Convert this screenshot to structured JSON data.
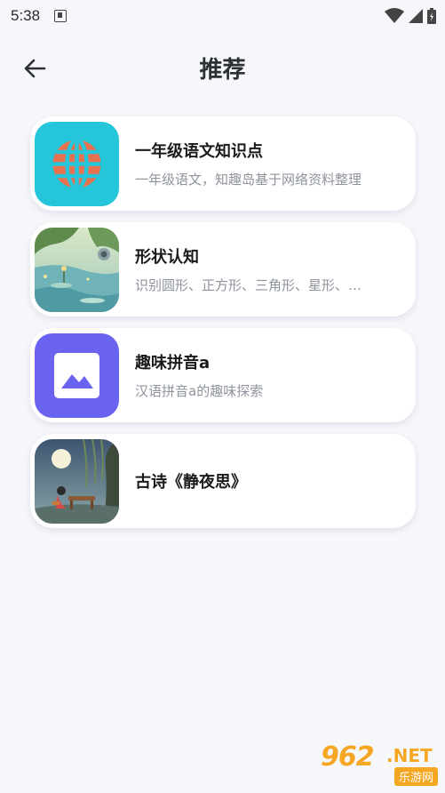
{
  "status_bar": {
    "time": "5:38"
  },
  "header": {
    "title": "推荐"
  },
  "colors": {
    "accent_teal": "#26c6da",
    "accent_purple": "#6a63f0",
    "globe_orange": "#e8714f"
  },
  "items": [
    {
      "title": "一年级语文知识点",
      "subtitle": "一年级语文，知趣岛基于网络资料整理",
      "icon": "globe-icon"
    },
    {
      "title": "形状认知",
      "subtitle": "识别圆形、正方形、三角形、星形、…",
      "icon": "landscape-painting"
    },
    {
      "title": "趣味拼音a",
      "subtitle": "汉语拼音a的趣味探索",
      "icon": "image-placeholder-icon"
    },
    {
      "title": "古诗《静夜思》",
      "subtitle": "",
      "icon": "moonlit-scene-painting"
    }
  ],
  "watermark": {
    "brand": "962",
    "domain": ".NET",
    "label": "乐游网"
  }
}
